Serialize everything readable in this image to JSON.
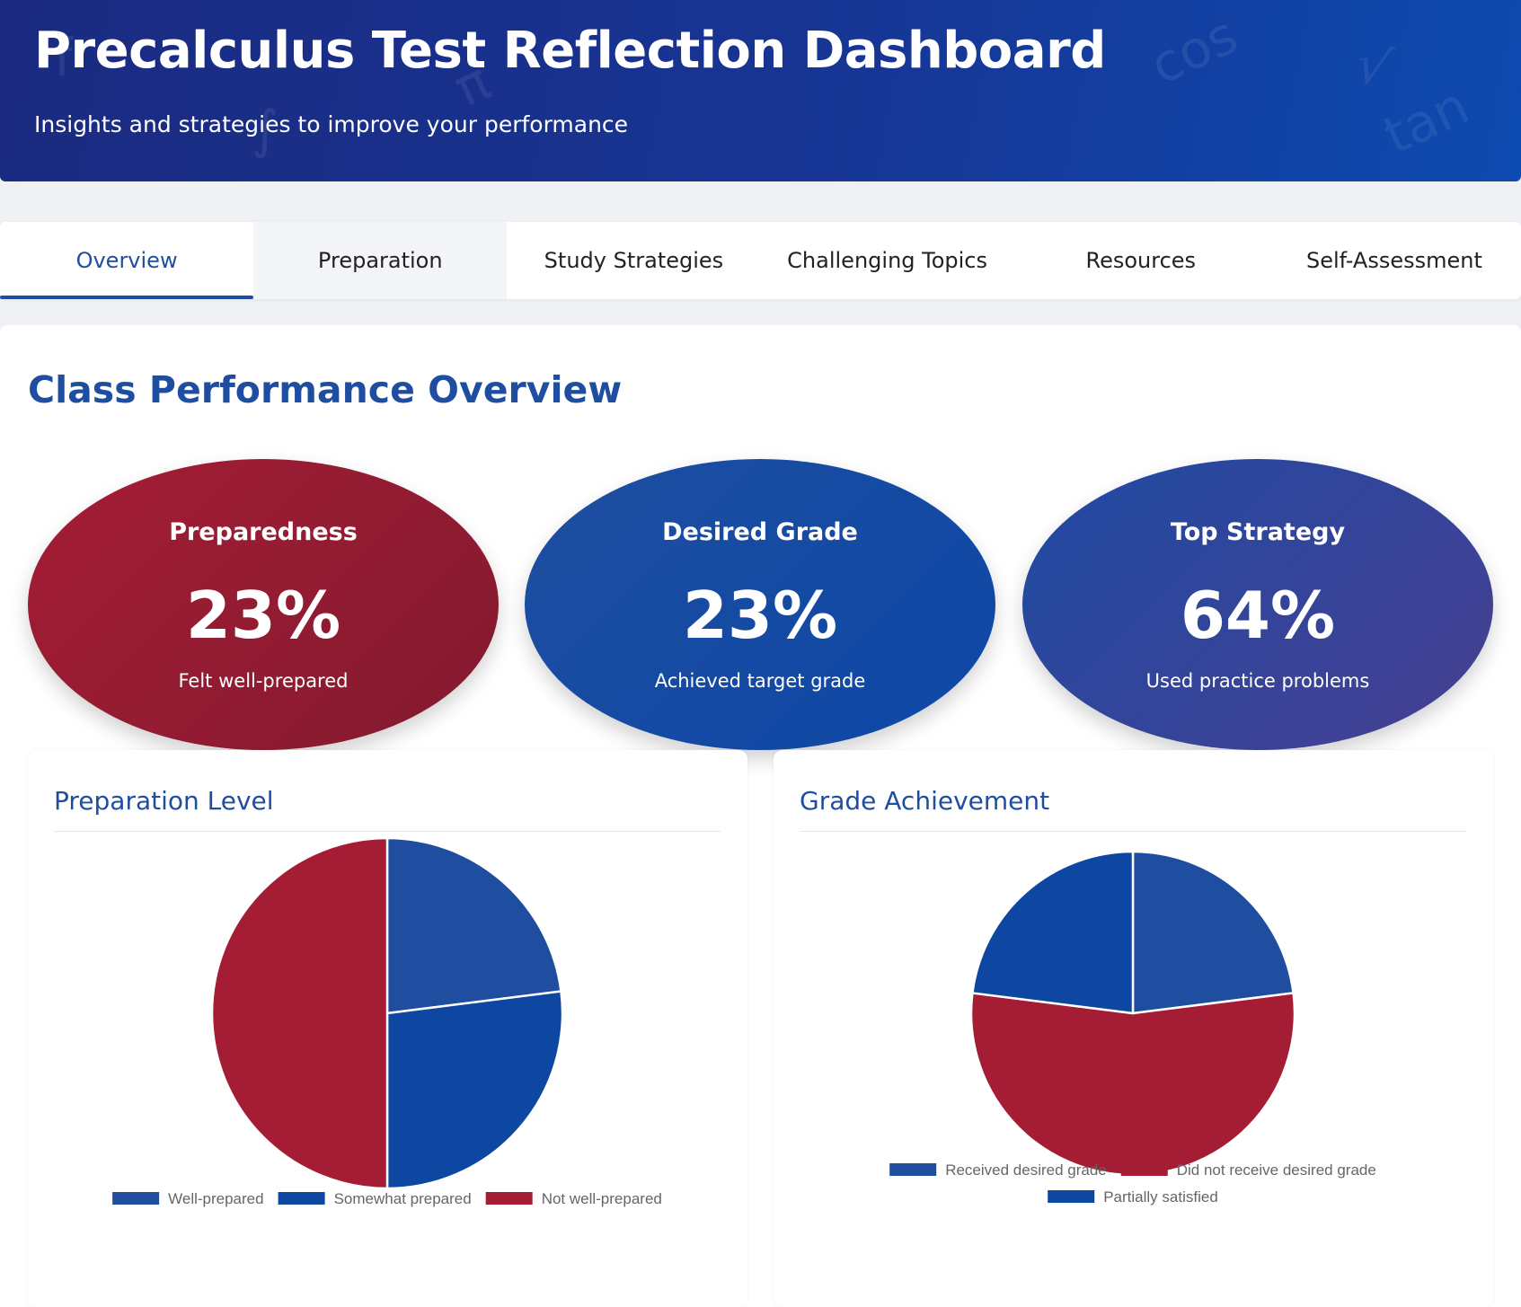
{
  "header": {
    "title": "Precalculus Test Reflection Dashboard",
    "subtitle": "Insights and strategies to improve your performance",
    "decorations": [
      "f",
      "π",
      "cos",
      "√",
      "tan",
      "∫"
    ]
  },
  "tabs": [
    {
      "label": "Overview",
      "active": true
    },
    {
      "label": "Preparation",
      "active": false
    },
    {
      "label": "Study Strategies",
      "active": false
    },
    {
      "label": "Challenging Topics",
      "active": false
    },
    {
      "label": "Resources",
      "active": false
    },
    {
      "label": "Self-Assessment",
      "active": false
    }
  ],
  "overview": {
    "title": "Class Performance Overview",
    "stats": [
      {
        "label": "Preparedness",
        "value": "23%",
        "caption": "Felt well-prepared",
        "color": "#a51d35"
      },
      {
        "label": "Desired Grade",
        "value": "23%",
        "caption": "Achieved target grade",
        "color": "#1e4ea0"
      },
      {
        "label": "Top Strategy",
        "value": "64%",
        "caption": "Used practice problems",
        "color": "#473f92"
      }
    ]
  },
  "chart_data": [
    {
      "type": "pie",
      "title": "Preparation Level",
      "categories": [
        "Well-prepared",
        "Somewhat prepared",
        "Not well-prepared"
      ],
      "values": [
        23,
        27,
        50
      ],
      "colors": [
        "#1f4ea1",
        "#0d47a1",
        "#a51d35"
      ],
      "legend": "bottom"
    },
    {
      "type": "pie",
      "title": "Grade Achievement",
      "categories": [
        "Received desired grade",
        "Did not receive desired grade",
        "Partially satisfied"
      ],
      "values": [
        23,
        54,
        23
      ],
      "colors": [
        "#1f4ea1",
        "#a51d35",
        "#0d47a1"
      ],
      "legend": "bottom"
    }
  ]
}
